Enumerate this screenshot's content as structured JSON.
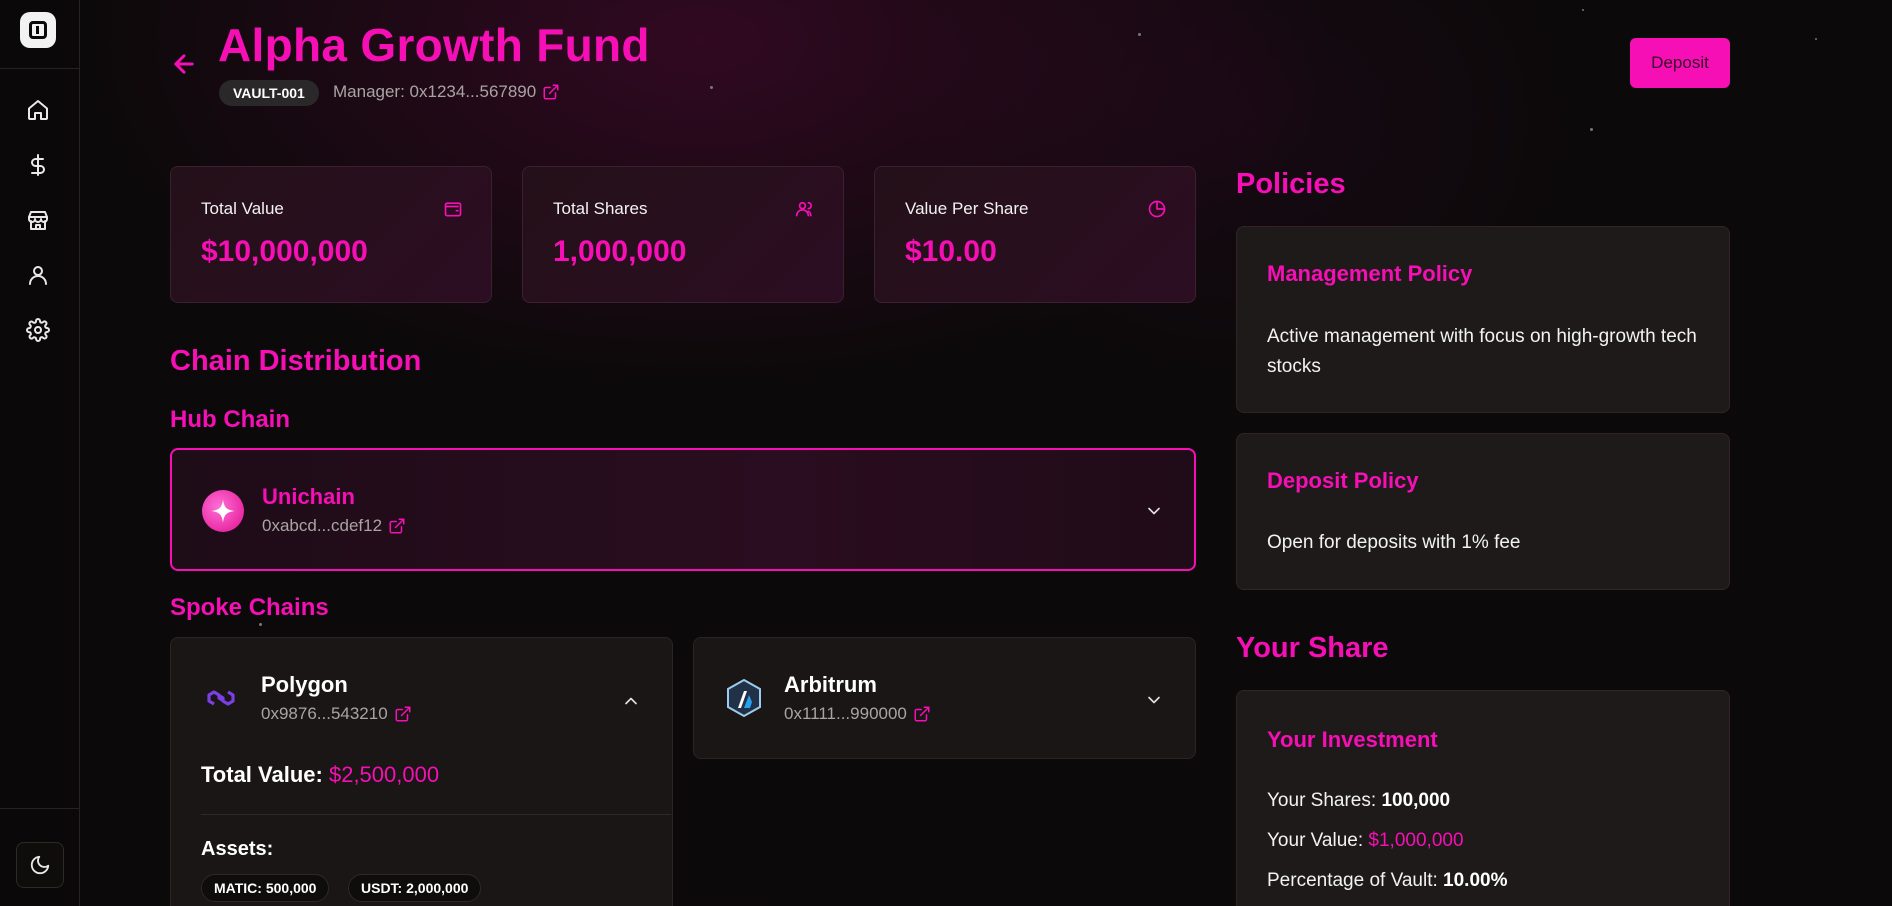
{
  "sidebar": {
    "items": [
      {
        "icon": "home-icon"
      },
      {
        "icon": "dollar-icon"
      },
      {
        "icon": "store-icon"
      },
      {
        "icon": "user-icon"
      },
      {
        "icon": "gear-icon"
      }
    ],
    "theme_icon": "moon-icon"
  },
  "header": {
    "title": "Alpha Growth Fund",
    "vault_id": "VAULT-001",
    "manager_label": "Manager: 0x1234...567890",
    "deposit_label": "Deposit"
  },
  "stats": [
    {
      "label": "Total Value",
      "value": "$10,000,000",
      "icon": "wallet-icon"
    },
    {
      "label": "Total Shares",
      "value": "1,000,000",
      "icon": "users-icon"
    },
    {
      "label": "Value Per Share",
      "value": "$10.00",
      "icon": "pie-chart-icon"
    }
  ],
  "chain_distribution": {
    "title": "Chain Distribution",
    "hub_title": "Hub Chain",
    "hub": {
      "name": "Unichain",
      "address": "0xabcd...cdef12"
    },
    "spoke_title": "Spoke Chains",
    "spokes": [
      {
        "name": "Polygon",
        "address": "0x9876...543210",
        "total_label": "Total Value:",
        "total_value": "$2,500,000",
        "assets_label": "Assets:",
        "assets": [
          "MATIC: 500,000",
          "USDT: 2,000,000"
        ],
        "expanded": true
      },
      {
        "name": "Arbitrum",
        "address": "0x1111...990000",
        "expanded": false
      }
    ]
  },
  "policies": {
    "title": "Policies",
    "items": [
      {
        "title": "Management Policy",
        "text": "Active management with focus on high-growth tech stocks"
      },
      {
        "title": "Deposit Policy",
        "text": "Open for deposits with 1% fee"
      }
    ]
  },
  "your_share": {
    "title": "Your Share",
    "card_title": "Your Investment",
    "shares_label": "Your Shares:",
    "shares_value": "100,000",
    "value_label": "Your Value:",
    "value_value": "$1,000,000",
    "pct_label": "Percentage of Vault:",
    "pct_value": "10.00%"
  },
  "colors": {
    "accent": "#f50fb4",
    "background": "#0b0909",
    "card": "#1a1616"
  }
}
